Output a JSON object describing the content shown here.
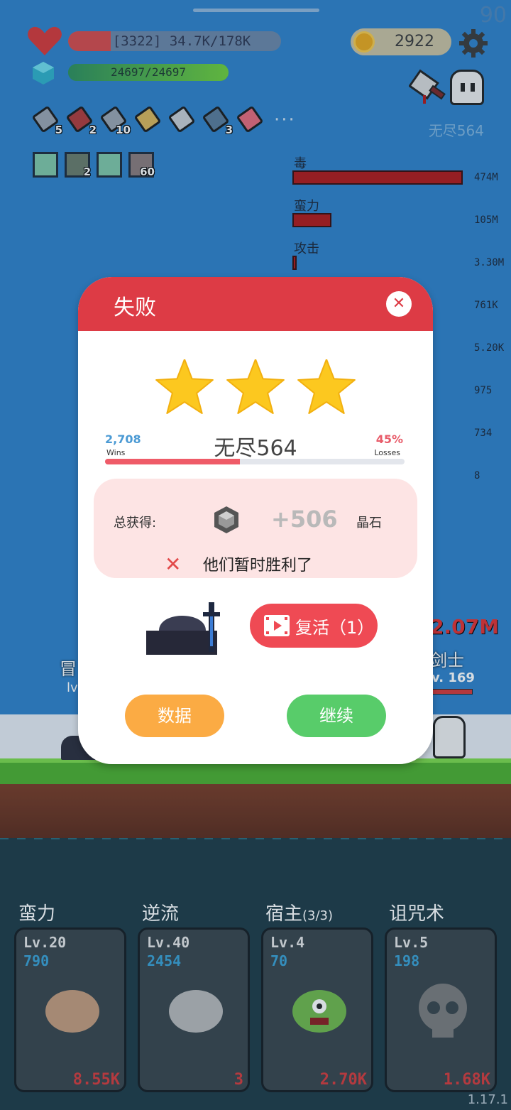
{
  "hud": {
    "fps": "90",
    "hp_text": "[3322] 34.7K/178K",
    "hp_fraction": 0.2,
    "mp_text": "24697/24697",
    "mp_fraction": 1.0,
    "coins": "2922",
    "endless_stage": "无尽564"
  },
  "items": [
    {
      "icon": "sword-icon",
      "count": "5"
    },
    {
      "icon": "potion-jar-icon",
      "count": "2"
    },
    {
      "icon": "dagger-icon",
      "count": "10"
    },
    {
      "icon": "scroll-icon",
      "count": ""
    },
    {
      "icon": "broadsword-icon",
      "count": ""
    },
    {
      "icon": "shield-icon",
      "count": "3"
    },
    {
      "icon": "spray-bottle-icon",
      "count": ""
    }
  ],
  "more": "···",
  "runes": [
    {
      "icon": "lightbulb-rune-icon",
      "count": ""
    },
    {
      "icon": "hammer-rune-icon",
      "count": "2"
    },
    {
      "icon": "lightbulb-rune-icon",
      "count": ""
    },
    {
      "icon": "blade-rune-icon",
      "count": "60"
    }
  ],
  "damage": [
    {
      "label": "毒",
      "value": "474M",
      "fraction": 1.0
    },
    {
      "label": "蛮力",
      "value": "105M",
      "fraction": 0.23
    },
    {
      "label": "攻击",
      "value": "3.30M",
      "fraction": 0.02
    },
    {
      "label": "",
      "value": "761K",
      "fraction": 0
    },
    {
      "label": "",
      "value": "5.20K",
      "fraction": 0
    },
    {
      "label": "",
      "value": "975",
      "fraction": 0
    },
    {
      "label": "",
      "value": "734",
      "fraction": 0
    },
    {
      "label": "",
      "value": "8",
      "fraction": 0
    }
  ],
  "battle": {
    "enemy_damage": "2.07M",
    "enemy_name": "剑士",
    "enemy_level": "v. 169",
    "player_name": "冒",
    "player_level": "lv"
  },
  "dialog": {
    "title": "失败",
    "stars": 3,
    "stage": "无尽564",
    "wins": "2,708",
    "wins_label": "Wins",
    "losses": "45%",
    "losses_label": "Losses",
    "loss_fraction": 0.45,
    "reward_label": "总获得:",
    "reward_amount": "+506",
    "reward_unit": "晶石",
    "fail_message": "他们暂时胜利了",
    "revive_label": "复活（1）",
    "data_button": "数据",
    "continue_button": "继续"
  },
  "skills": [
    {
      "title": "蛮力",
      "sub": "",
      "level": "Lv.20",
      "xp": "790",
      "cost": "8.55K",
      "icon": "muscle-arm-icon"
    },
    {
      "title": "逆流",
      "sub": "",
      "level": "Lv.40",
      "xp": "2454",
      "cost": "3",
      "icon": "wing-icon"
    },
    {
      "title": "宿主",
      "sub": "(3/3)",
      "level": "Lv.4",
      "xp": "70",
      "cost": "2.70K",
      "icon": "green-monster-icon"
    },
    {
      "title": "诅咒术",
      "sub": "",
      "level": "Lv.5",
      "xp": "198",
      "cost": "1.68K",
      "icon": "skull-icon"
    }
  ],
  "version": "1.17.1",
  "colors": {
    "accent_red": "#dd3b45",
    "win_blue": "#4b9ad4",
    "loss_red": "#ef5b68",
    "continue_green": "#58cc6a",
    "data_orange": "#fbab44"
  }
}
